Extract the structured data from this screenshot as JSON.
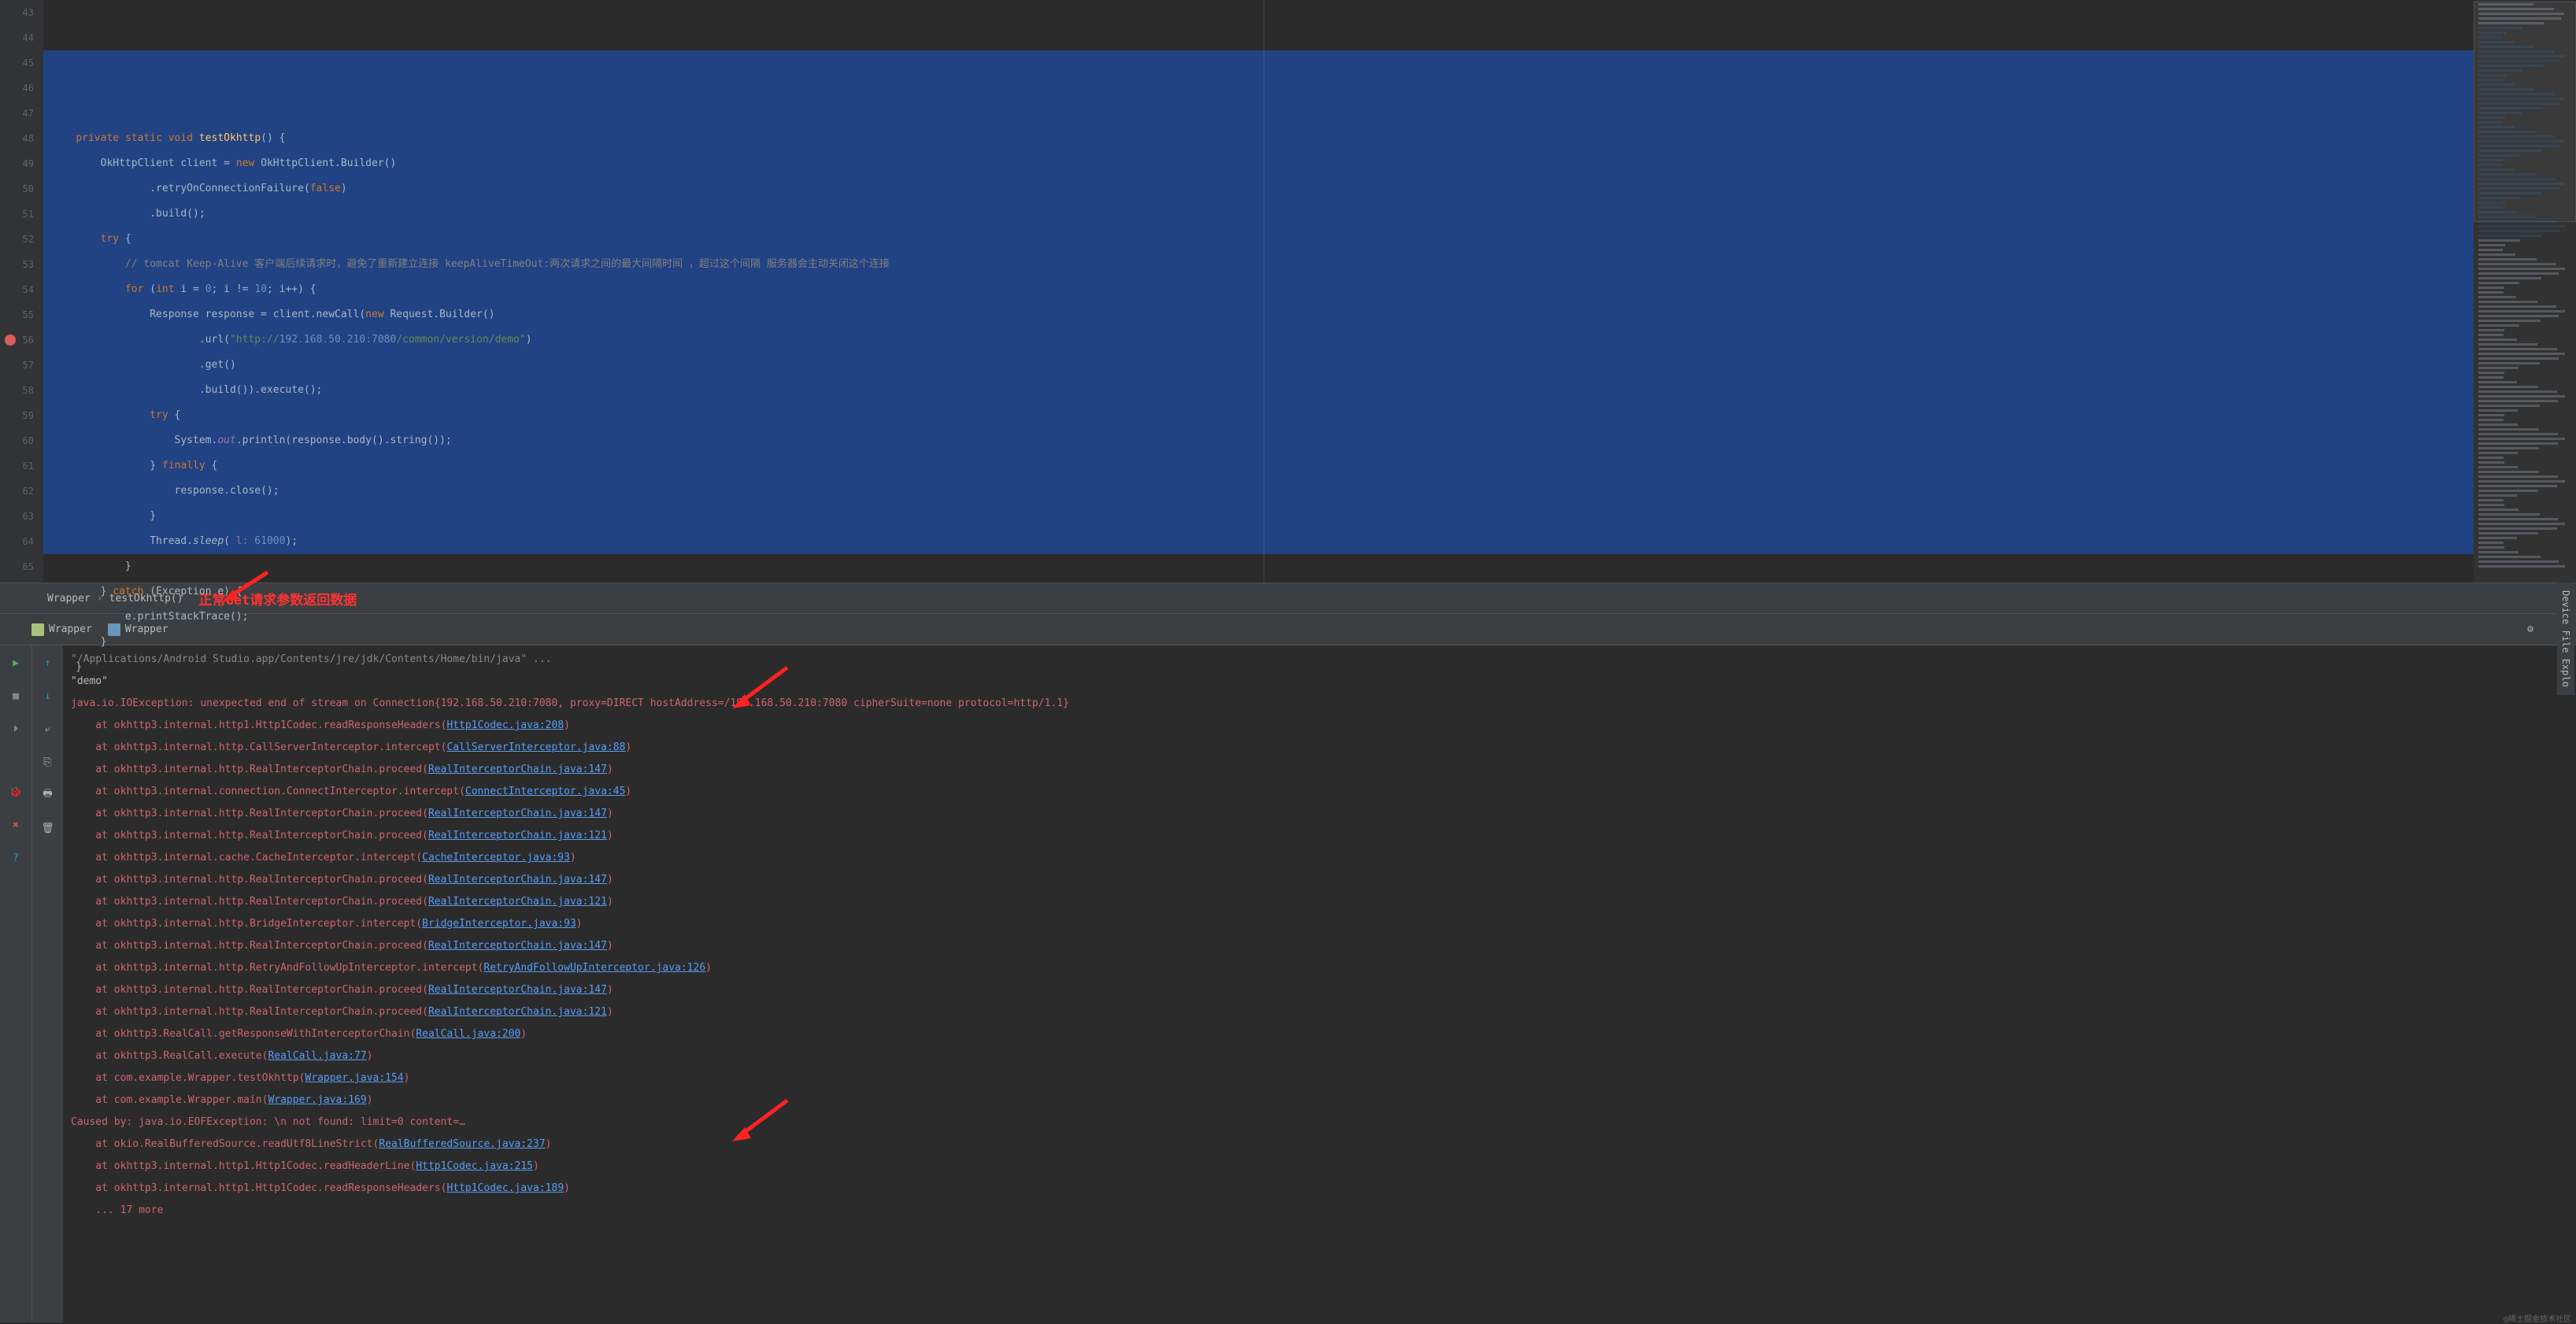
{
  "editor": {
    "line_start": 43,
    "code_lines": [
      {
        "n": 43,
        "raw": ""
      },
      {
        "n": 44,
        "raw": "    private static void testOkhttp() {"
      },
      {
        "n": 45,
        "raw": "        OkHttpClient client = new OkHttpClient.Builder()"
      },
      {
        "n": 46,
        "raw": "                .retryOnConnectionFailure(false)"
      },
      {
        "n": 47,
        "raw": "                .build();"
      },
      {
        "n": 48,
        "raw": "        try {"
      },
      {
        "n": 49,
        "raw": "            // tomcat Keep-Alive 客户端后续请求时，避免了重新建立连接 keepAliveTimeOut:两次请求之间的最大间隔时间 ，超过这个间隔 服务器会主动关闭这个连接"
      },
      {
        "n": 50,
        "raw": "            for (int i = 0; i != 10; i++) {"
      },
      {
        "n": 51,
        "raw": "                Response response = client.newCall(new Request.Builder()"
      },
      {
        "n": 52,
        "raw": "                        .url(\"http://192.168.50.210:7080/common/version/demo\")"
      },
      {
        "n": 53,
        "raw": "                        .get()"
      },
      {
        "n": 54,
        "raw": "                        .build()).execute();"
      },
      {
        "n": 55,
        "raw": "                try {"
      },
      {
        "n": 56,
        "raw": "                    System.out.println(response.body().string());"
      },
      {
        "n": 57,
        "raw": "                } finally {"
      },
      {
        "n": 58,
        "raw": "                    response.close();"
      },
      {
        "n": 59,
        "raw": "                }"
      },
      {
        "n": 60,
        "raw": "                Thread.sleep( l: 61000);"
      },
      {
        "n": 61,
        "raw": "            }"
      },
      {
        "n": 62,
        "raw": "        } catch (Exception e) {"
      },
      {
        "n": 63,
        "raw": "            e.printStackTrace();"
      },
      {
        "n": 64,
        "raw": "        }"
      },
      {
        "n": 65,
        "raw": "    }"
      }
    ],
    "selection_start_line": 45,
    "selection_end_line": 64,
    "breakpoint_line": 56
  },
  "breadcrumb": {
    "item1": "Wrapper",
    "item2": "testOkhttp()",
    "annotation": "正常Get请求参数返回数据"
  },
  "tabs": {
    "tab1": "Wrapper",
    "tab2": "Wrapper"
  },
  "console": {
    "lines": [
      {
        "cls": "out-gray",
        "text": "\"/Applications/Android Studio.app/Contents/jre/jdk/Contents/Home/bin/java\" ..."
      },
      {
        "cls": "out-white",
        "text": "\"demo\""
      },
      {
        "cls": "out-red",
        "text": "java.io.IOException: unexpected end of stream on Connection{192.168.50.210:7080, proxy=DIRECT hostAddress=/192.168.50.210:7080 cipherSuite=none protocol=http/1.1}"
      },
      {
        "cls": "out-red",
        "text": "    at okhttp3.internal.http1.Http1Codec.readResponseHeaders(",
        "link": "Http1Codec.java:208",
        "tail": ")"
      },
      {
        "cls": "out-red",
        "text": "    at okhttp3.internal.http.CallServerInterceptor.intercept(",
        "link": "CallServerInterceptor.java:88",
        "tail": ")"
      },
      {
        "cls": "out-red",
        "text": "    at okhttp3.internal.http.RealInterceptorChain.proceed(",
        "link": "RealInterceptorChain.java:147",
        "tail": ")"
      },
      {
        "cls": "out-red",
        "text": "    at okhttp3.internal.connection.ConnectInterceptor.intercept(",
        "link": "ConnectInterceptor.java:45",
        "tail": ")"
      },
      {
        "cls": "out-red",
        "text": "    at okhttp3.internal.http.RealInterceptorChain.proceed(",
        "link": "RealInterceptorChain.java:147",
        "tail": ")"
      },
      {
        "cls": "out-red",
        "text": "    at okhttp3.internal.http.RealInterceptorChain.proceed(",
        "link": "RealInterceptorChain.java:121",
        "tail": ")"
      },
      {
        "cls": "out-red",
        "text": "    at okhttp3.internal.cache.CacheInterceptor.intercept(",
        "link": "CacheInterceptor.java:93",
        "tail": ")"
      },
      {
        "cls": "out-red",
        "text": "    at okhttp3.internal.http.RealInterceptorChain.proceed(",
        "link": "RealInterceptorChain.java:147",
        "tail": ")"
      },
      {
        "cls": "out-red",
        "text": "    at okhttp3.internal.http.RealInterceptorChain.proceed(",
        "link": "RealInterceptorChain.java:121",
        "tail": ")"
      },
      {
        "cls": "out-red",
        "text": "    at okhttp3.internal.http.BridgeInterceptor.intercept(",
        "link": "BridgeInterceptor.java:93",
        "tail": ")"
      },
      {
        "cls": "out-red",
        "text": "    at okhttp3.internal.http.RealInterceptorChain.proceed(",
        "link": "RealInterceptorChain.java:147",
        "tail": ")"
      },
      {
        "cls": "out-red",
        "text": "    at okhttp3.internal.http.RetryAndFollowUpInterceptor.intercept(",
        "link": "RetryAndFollowUpInterceptor.java:126",
        "tail": ")"
      },
      {
        "cls": "out-red",
        "text": "    at okhttp3.internal.http.RealInterceptorChain.proceed(",
        "link": "RealInterceptorChain.java:147",
        "tail": ")"
      },
      {
        "cls": "out-red",
        "text": "    at okhttp3.internal.http.RealInterceptorChain.proceed(",
        "link": "RealInterceptorChain.java:121",
        "tail": ")"
      },
      {
        "cls": "out-red",
        "text": "    at okhttp3.RealCall.getResponseWithInterceptorChain(",
        "link": "RealCall.java:200",
        "tail": ")"
      },
      {
        "cls": "out-red",
        "text": "    at okhttp3.RealCall.execute(",
        "link": "RealCall.java:77",
        "tail": ")"
      },
      {
        "cls": "out-red",
        "text": "    at com.example.Wrapper.testOkhttp(",
        "link": "Wrapper.java:154",
        "tail": ")"
      },
      {
        "cls": "out-red",
        "text": "    at com.example.Wrapper.main(",
        "link": "Wrapper.java:169",
        "tail": ")"
      },
      {
        "cls": "out-red",
        "text": "Caused by: java.io.EOFException: \\n not found: limit=0 content=…"
      },
      {
        "cls": "out-red",
        "text": "    at okio.RealBufferedSource.readUtf8LineStrict(",
        "link": "RealBufferedSource.java:237",
        "tail": ")"
      },
      {
        "cls": "out-red",
        "text": "    at okhttp3.internal.http1.Http1Codec.readHeaderLine(",
        "link": "Http1Codec.java:215",
        "tail": ")"
      },
      {
        "cls": "out-red",
        "text": "    at okhttp3.internal.http1.Http1Codec.readResponseHeaders(",
        "link": "Http1Codec.java:189",
        "tail": ")"
      },
      {
        "cls": "out-red",
        "text": "    ... 17 more"
      }
    ]
  },
  "side_tabs": {
    "right": "Device File Explo"
  },
  "watermark": "@稀土掘金技术社区"
}
